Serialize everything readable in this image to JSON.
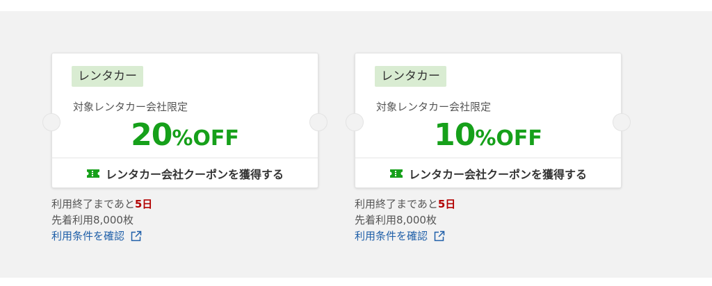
{
  "coupons": [
    {
      "category": "レンタカー",
      "target": "対象レンタカー会社限定",
      "discount_number": "20",
      "discount_unit": "%OFF",
      "get_label": "レンタカー会社クーポンを獲得する",
      "expiry_prefix": "利用終了まであと",
      "expiry_days": "5日",
      "quota": "先着利用8,000枚",
      "terms_link": "利用条件を確認"
    },
    {
      "category": "レンタカー",
      "target": "対象レンタカー会社限定",
      "discount_number": "10",
      "discount_unit": "%OFF",
      "get_label": "レンタカー会社クーポンを獲得する",
      "expiry_prefix": "利用終了まであと",
      "expiry_days": "5日",
      "quota": "先着利用8,000枚",
      "terms_link": "利用条件を確認"
    }
  ],
  "icons": {
    "ticket": "ticket-icon",
    "external": "external-link-icon"
  },
  "colors": {
    "discount": "#16a01a",
    "badge_bg": "#d9ecd2",
    "days": "#b20000",
    "link": "#1f5fa8",
    "background": "#f2f2f2"
  }
}
